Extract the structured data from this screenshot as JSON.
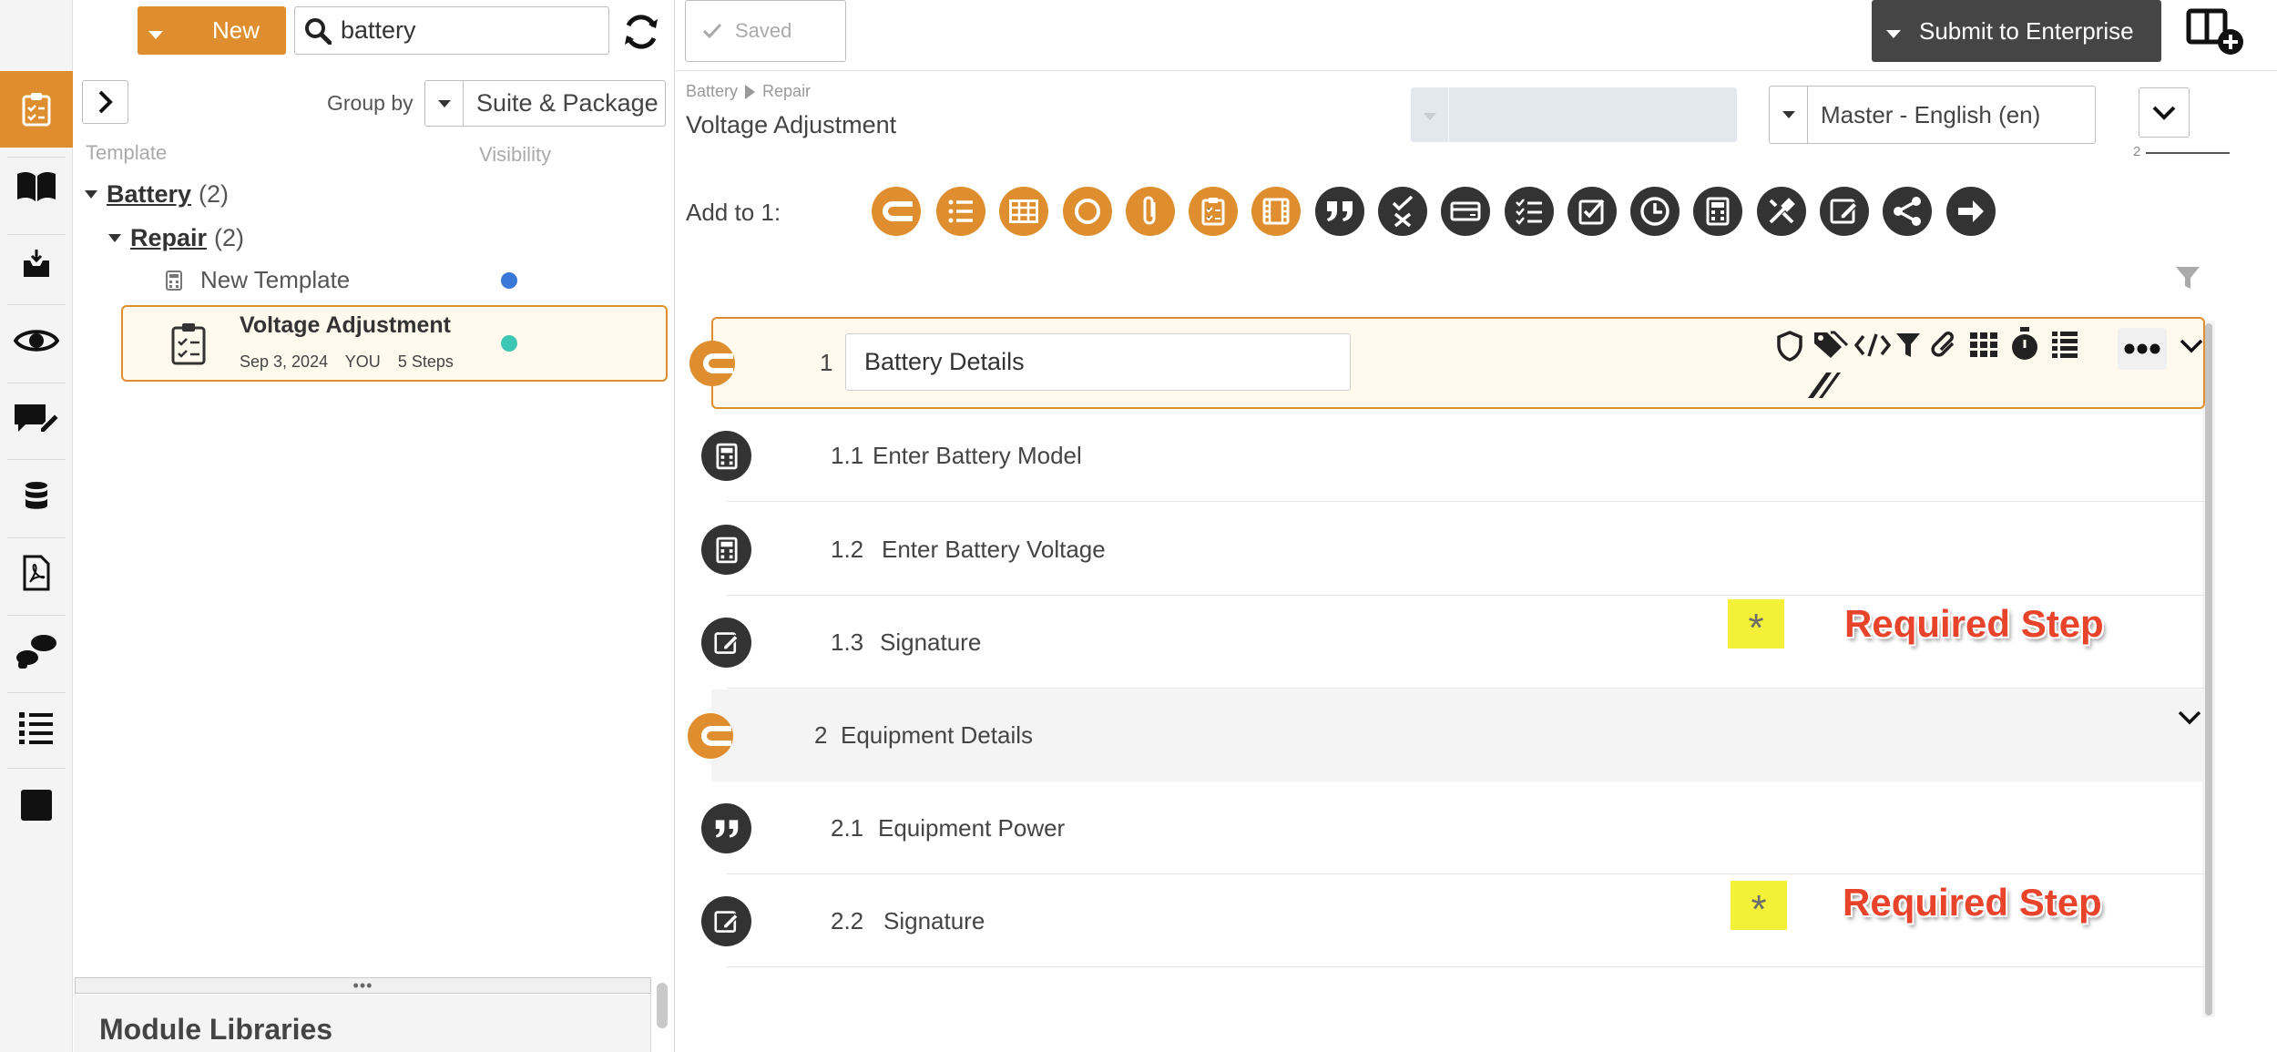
{
  "colors": {
    "accent": "#de8e2e",
    "dark_icon": "#333333",
    "submit_bg": "#454545",
    "visibility_blue": "#3a78d8",
    "visibility_teal": "#3cc7b4",
    "required_star_bg": "#f3f039",
    "required_label": "#e8432b"
  },
  "rail": {
    "items": [
      {
        "icon": "clipboard-checklist-icon",
        "active": true
      },
      {
        "icon": "book-icon"
      },
      {
        "icon": "inbox-download-icon"
      },
      {
        "icon": "eye-icon"
      },
      {
        "icon": "chat-edit-icon"
      },
      {
        "icon": "database-icon"
      },
      {
        "icon": "pdf-file-icon"
      },
      {
        "icon": "footsteps-icon"
      },
      {
        "icon": "numbered-list-icon"
      },
      {
        "icon": "square-icon"
      }
    ]
  },
  "panel": {
    "new_label": "New",
    "search_value": "battery",
    "group_by_label": "Group by",
    "group_by_value": "Suite & Package",
    "col_template": "Template",
    "col_visibility": "Visibility",
    "tree": {
      "battery": {
        "label": "Battery",
        "count": "(2)"
      },
      "repair": {
        "label": "Repair",
        "count": "(2)"
      },
      "new_template": {
        "label": "New Template"
      },
      "selected": {
        "name": "Voltage Adjustment",
        "date": "Sep 3, 2024",
        "owner": "YOU",
        "steps": "5 Steps"
      }
    },
    "module_libraries": "Module Libraries"
  },
  "editor": {
    "saved_label": "Saved",
    "submit_label": "Submit to Enterprise",
    "breadcrumb": [
      "Battery",
      "Repair"
    ],
    "title": "Voltage Adjustment",
    "language_value": "Master - English (en)",
    "version_number": "2",
    "add_to_label": "Add to 1:",
    "step_type_icons": [
      "section-icon",
      "list-icon",
      "table-icon",
      "circle-icon",
      "attachment-icon",
      "clipboard-icon",
      "film-icon",
      "quote-icon",
      "check-cross-icon",
      "card-icon",
      "checklist-icon",
      "checkbox-icon",
      "clock-icon",
      "calculator-icon",
      "tools-icon",
      "signature-icon",
      "share-icon",
      "arrow-right-icon"
    ],
    "sections": [
      {
        "number": "1",
        "title": "Battery Details",
        "steps": [
          {
            "number": "1.1",
            "title": "Enter Battery Model",
            "icon": "calculator-icon",
            "required": false
          },
          {
            "number": "1.2",
            "title": "Enter Battery Voltage",
            "icon": "calculator-icon",
            "required": false
          },
          {
            "number": "1.3",
            "title": "Signature",
            "icon": "signature-icon",
            "required": true
          }
        ]
      },
      {
        "number": "2",
        "title": "Equipment Details",
        "steps": [
          {
            "number": "2.1",
            "title": "Equipment Power",
            "icon": "quote-icon",
            "required": false
          },
          {
            "number": "2.2",
            "title": "Signature",
            "icon": "signature-icon",
            "required": true
          }
        ]
      }
    ],
    "required_step_label": "Required Step",
    "required_star": "*"
  }
}
